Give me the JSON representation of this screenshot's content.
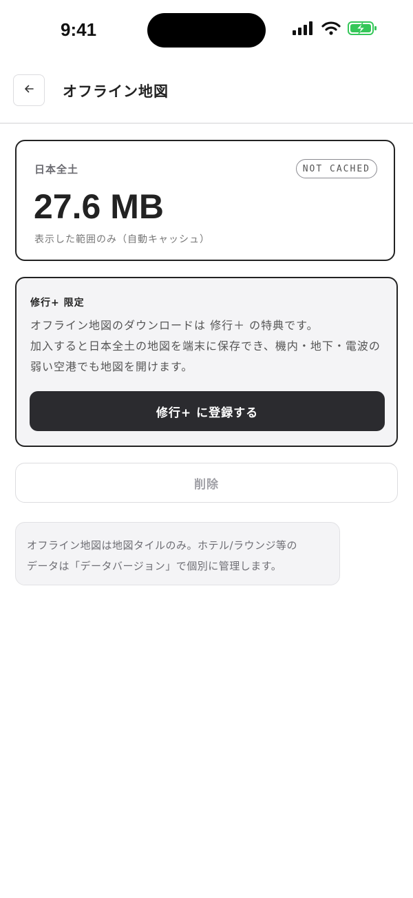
{
  "status_bar": {
    "time": "9:41"
  },
  "header": {
    "title": "オフライン地図"
  },
  "storage": {
    "region": "日本全土",
    "badge": "NOT CACHED",
    "size": "27.6 MB",
    "caption": "表示した範囲のみ（自動キャッシュ）"
  },
  "plus": {
    "title": "修行+ 限定",
    "body_line1": "オフライン地図のダウンロードは 修行＋ の特典です。",
    "body_line2": "加入すると日本全土の地図を端末に保存でき、機内・地下・電波の弱い空港でも地図を開けます。",
    "button_label": "修行+ に登録する"
  },
  "delete_button": {
    "label": "削除"
  },
  "note": {
    "line1": "オフライン地図は地図タイルのみ。ホテル/ラウンジ等の",
    "line2": "データは「データバージョン」で個別に管理します。"
  },
  "colors": {
    "battery_green": "#35c759",
    "dark_button": "#2b2b2f"
  },
  "icons": {
    "back": "arrow-left-icon",
    "signal": "signal-icon",
    "wifi": "wifi-icon",
    "battery": "battery-charging-icon"
  }
}
